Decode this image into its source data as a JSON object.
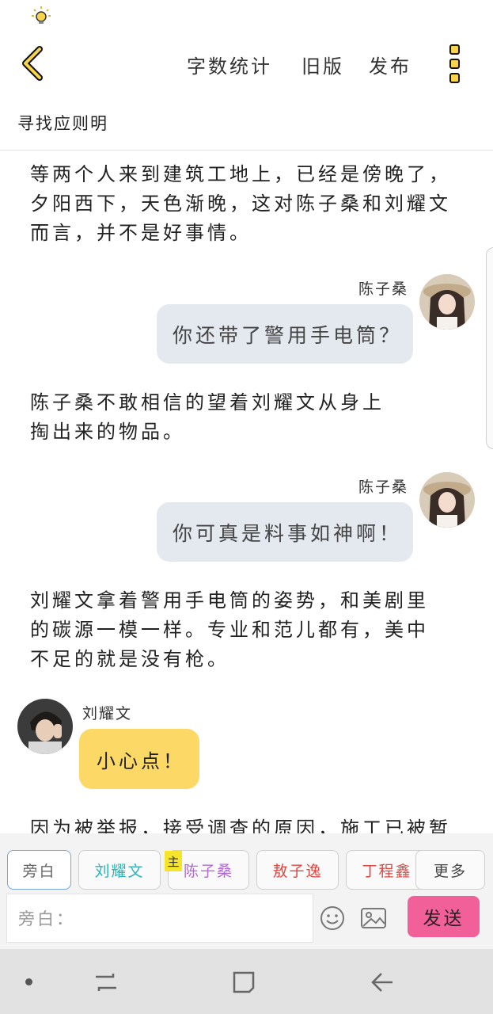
{
  "header": {
    "actions": [
      "字数统计",
      "旧版",
      "发布"
    ]
  },
  "subtitle": "寻找应则明",
  "story": {
    "narration_1": "等两个人来到建筑工地上，已经是傍晚了，夕阳西下，天色渐晚，这对陈子桑和刘耀文而言，并不是好事情。",
    "dialog_1": {
      "name": "陈子桑",
      "text": "你还带了警用手电筒？"
    },
    "narration_2": "陈子桑不敢相信的望着刘耀文从身上掏出来的物品。",
    "dialog_2": {
      "name": "陈子桑",
      "text": "你可真是料事如神啊！"
    },
    "narration_3": "刘耀文拿着警用手电筒的姿势，和美剧里的碳源一模一样。专业和范儿都有，美中不足的就是没有枪。",
    "dialog_3": {
      "name": "刘耀文",
      "text": "小心点！"
    },
    "narration_4": "因为被举报，接受调查的原因，施工已被暂"
  },
  "roles": [
    {
      "label": "旁白",
      "color": "#666666"
    },
    {
      "label": "刘耀文",
      "color": "#2bb3b8"
    },
    {
      "label": "陈子桑",
      "color": "#b06ad0"
    },
    {
      "label": "敖子逸",
      "color": "#e0453f"
    },
    {
      "label": "丁程鑫",
      "color": "#e0453f"
    },
    {
      "label": "更多",
      "color": "#444444"
    }
  ],
  "main_tag": "主",
  "input": {
    "prefix": "旁白："
  },
  "send_label": "发送",
  "colors": {
    "accent_yellow": "#fcd967",
    "send_pink": "#f2609a",
    "bubble_grey": "#e4e8ef"
  },
  "icons": [
    "lightbulb-icon",
    "back-arrow-icon",
    "more-icon",
    "emoji-icon",
    "image-icon",
    "nav-recents-icon",
    "nav-home-icon",
    "nav-back-icon"
  ]
}
